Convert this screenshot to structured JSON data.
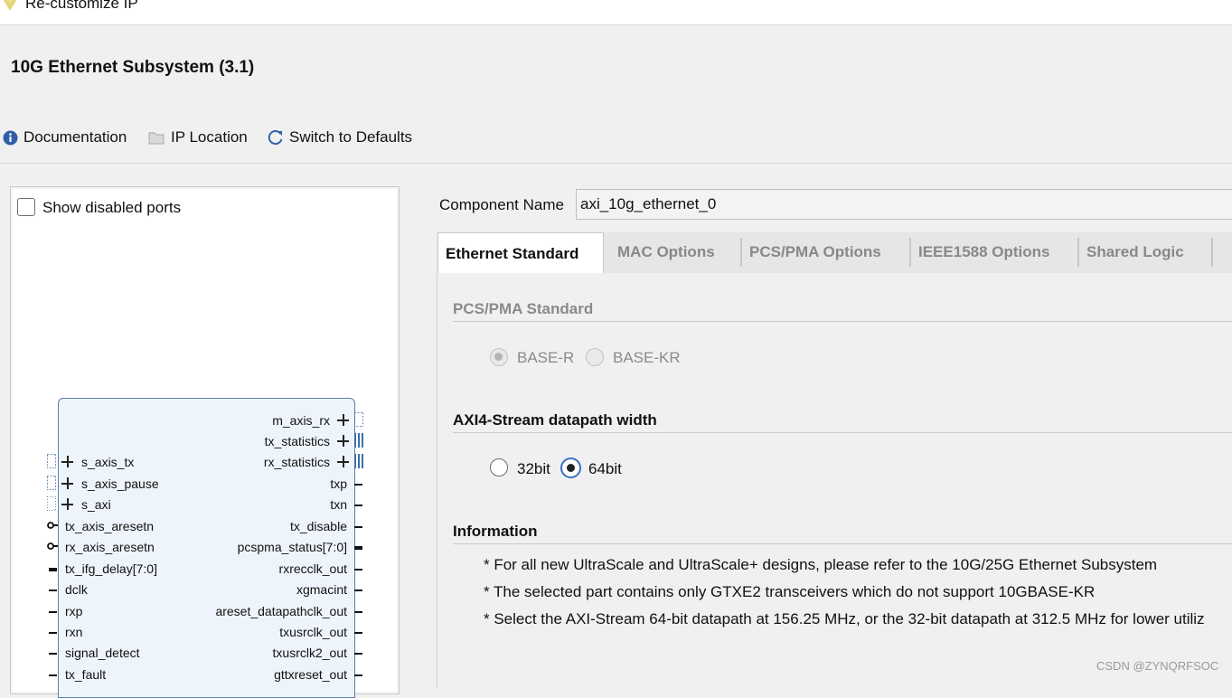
{
  "window": {
    "title": "Re-customize IP"
  },
  "ip": {
    "name": "10G Ethernet Subsystem (3.1)"
  },
  "toolbar": {
    "documentation": "Documentation",
    "ip_location": "IP Location",
    "switch_defaults": "Switch to Defaults"
  },
  "left_panel": {
    "show_disabled_ports": "Show disabled ports",
    "show_disabled_checked": false,
    "right_ports": [
      "m_axis_rx",
      "tx_statistics",
      "rx_statistics",
      "txp",
      "txn",
      "tx_disable",
      "pcspma_status[7:0]",
      "rxrecclk_out",
      "xgmacint",
      "areset_datapathclk_out",
      "txusrclk_out",
      "txusrclk2_out",
      "gttxreset_out"
    ],
    "left_ports": [
      "s_axis_tx",
      "s_axis_pause",
      "s_axi",
      "tx_axis_aresetn",
      "rx_axis_aresetn",
      "tx_ifg_delay[7:0]",
      "dclk",
      "rxp",
      "rxn",
      "signal_detect",
      "tx_fault"
    ]
  },
  "component": {
    "label": "Component Name",
    "value": "axi_10g_ethernet_0"
  },
  "tabs": [
    "Ethernet Standard",
    "MAC Options",
    "PCS/PMA Options",
    "IEEE1588 Options",
    "Shared Logic"
  ],
  "active_tab": "Ethernet Standard",
  "pcs_pma": {
    "heading": "PCS/PMA Standard",
    "options": [
      "BASE-R",
      "BASE-KR"
    ],
    "selected": "BASE-R",
    "enabled": false
  },
  "datapath": {
    "heading": "AXI4-Stream datapath width",
    "options": [
      "32bit",
      "64bit"
    ],
    "selected": "64bit"
  },
  "information": {
    "heading": "Information",
    "lines": [
      "* For all new UltraScale and UltraScale+ designs, please refer to the 10G/25G Ethernet Subsystem",
      "* The selected part contains only GTXE2 transceivers which do not support 10GBASE-KR",
      "* Select the AXI-Stream 64-bit datapath at 156.25 MHz, or the 32-bit datapath at 312.5 MHz for lower utiliz"
    ]
  },
  "watermark": "CSDN @ZYNQRFSOC",
  "colors": {
    "accent": "#3a6fc4",
    "bus": "#3a6fa8",
    "symbol_fill": "#eef4fb"
  }
}
